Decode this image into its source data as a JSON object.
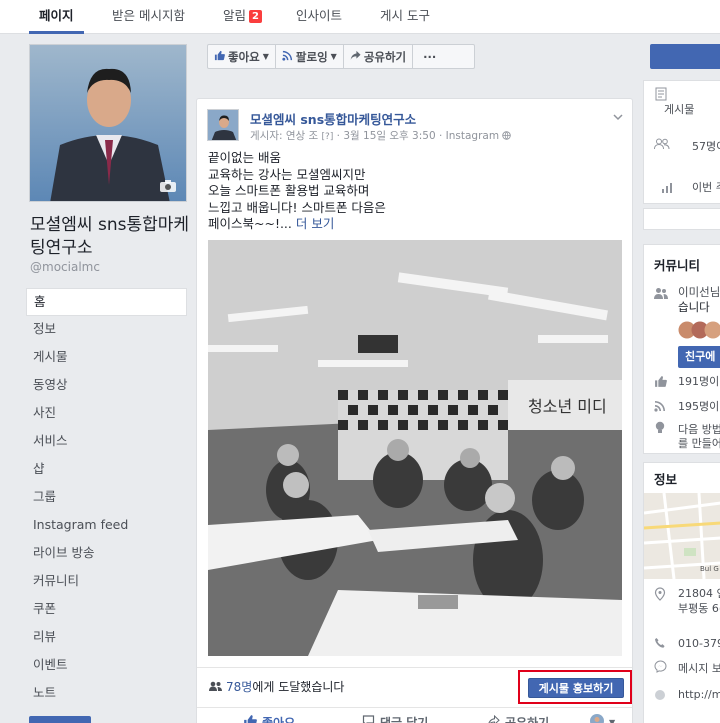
{
  "tabs": [
    {
      "label": "페이지"
    },
    {
      "label": "받은 메시지함"
    },
    {
      "label": "알림"
    },
    {
      "label": "인사이트"
    },
    {
      "label": "게시 도구"
    }
  ],
  "notification_count": "2",
  "page": {
    "name": "모셜엠씨 sns통합마케팅연구소",
    "handle": "@mocialmc"
  },
  "nav": [
    "홈",
    "정보",
    "게시물",
    "동영상",
    "사진",
    "서비스",
    "샵",
    "그룹",
    "Instagram feed",
    "라이브 방송",
    "커뮤니티",
    "쿠폰",
    "리뷰",
    "이벤트",
    "노트"
  ],
  "action_bar": {
    "like": "좋아요",
    "follow": "팔로잉",
    "share": "공유하기",
    "more": "···"
  },
  "post": {
    "author": "모셜엠씨 sns통합마케팅연구소",
    "meta_prefix": "게시자: 연상 조",
    "meta_q": "[?]",
    "meta_date": "3월 15일 오후 3:50",
    "meta_source": "Instagram",
    "text_lines": [
      "끝이없는 배움",
      "교육하는 강사는 모셜엠씨지만",
      "오늘 스마트폰 활용법 교육하며",
      "느낍고 배웁니다! 스마트폰 다음은"
    ],
    "text_last": "페이스북~~!...",
    "more_link": "더 보기",
    "photo_banner": "청소년 미디",
    "reach_count": "78명",
    "reach_suffix": "에게 도달했습니다",
    "promote_label": "게시물 홍보하기",
    "actions": {
      "like": "좋아요",
      "comment": "댓글 달기",
      "share": "공유하기"
    }
  },
  "right": {
    "top_rows": [
      "게시물",
      "57명이",
      "이번 주"
    ],
    "community_title": "커뮤니티",
    "community_invite": "이미선님",
    "community_invite2": "습니다",
    "invite_button": "친구에",
    "likes": "191명이",
    "follows": "195명이",
    "tip1": "다음 방법",
    "tip2": "를 만들어",
    "info_title": "정보",
    "address1": "21804 인",
    "address2": "부평동 6(",
    "phone": "010-3795",
    "message": "메시지 보",
    "website": "http://mo",
    "map_label": "Bul G"
  }
}
